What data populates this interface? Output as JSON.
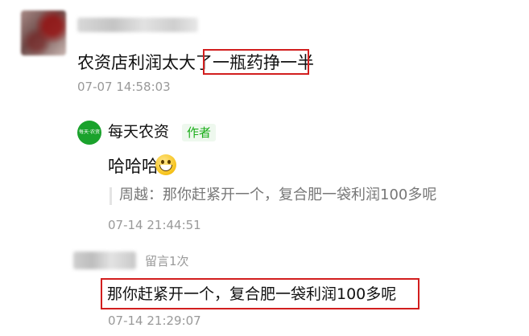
{
  "comment": {
    "text_prefix": "农资店利润太大了",
    "text_highlight": "一瓶药挣一半",
    "timestamp": "07-07 14:58:03"
  },
  "author_reply": {
    "brand_name": "每天农资",
    "logo_text": "每天·农资",
    "badge": "作者",
    "text": "哈哈哈",
    "emoji": "grinning-face-icon",
    "quote": "周越：那你赶紧开一个，复合肥一袋利润100多呢",
    "timestamp": "07-14 21:44:51"
  },
  "second_comment": {
    "message_count": "留言1次",
    "text": "那你赶紧开一个，复合肥一袋利润100多呢",
    "timestamp": "07-14 21:29:07"
  },
  "colors": {
    "highlight_border": "#d21e1e",
    "brand_green": "#1aa22c",
    "timestamp": "#999999"
  }
}
